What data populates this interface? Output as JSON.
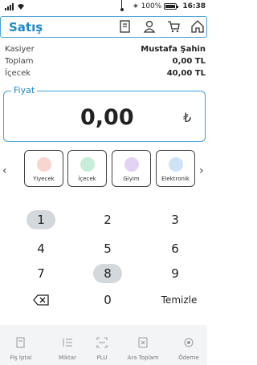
{
  "status_bar": {
    "battery_text": "100%",
    "time": "16:38",
    "icons": [
      "signal-icon",
      "wifi-icon",
      "bluetooth-icon",
      "battery-icon"
    ]
  },
  "header": {
    "title": "Satış",
    "icons": [
      "receipt-icon",
      "user-icon",
      "cart-icon",
      "home-icon"
    ]
  },
  "info": [
    {
      "label": "Kasiyer",
      "value": "Mustafa Şahin"
    },
    {
      "label": "Toplam",
      "value": "0,00 TL"
    },
    {
      "label": "İçecek",
      "value": "40,00 TL"
    }
  ],
  "price": {
    "label": "Fiyat",
    "value": "0,00",
    "currency": "₺"
  },
  "categories": [
    {
      "label": "Yiyecek",
      "icon": "utensils-icon",
      "color": "#f9d5cf"
    },
    {
      "label": "İçecek",
      "icon": "cup-icon",
      "color": "#c7ecd8"
    },
    {
      "label": "Giyim",
      "icon": "shirt-icon",
      "color": "#e3d3f2"
    },
    {
      "label": "Elektronik",
      "icon": "laptop-icon",
      "color": "#cfe3f6"
    }
  ],
  "keypad": {
    "k1": "1",
    "k2": "2",
    "k3": "3",
    "k4": "4",
    "k5": "5",
    "k6": "6",
    "k7": "7",
    "k8": "8",
    "k9": "9",
    "k0": "0",
    "clear": "Temizle"
  },
  "bottom_nav": [
    {
      "label": "Fiş İptal",
      "icon": "receipt-cancel-icon"
    },
    {
      "label": "Miktar",
      "icon": "quantity-icon"
    },
    {
      "label": "PLU",
      "icon": "scan-icon"
    },
    {
      "label": "Ara Toplam",
      "icon": "subtotal-icon"
    },
    {
      "label": "Ödeme",
      "icon": "payment-icon"
    }
  ],
  "colors": {
    "accent": "#1e88c9",
    "border": "#3da0dc",
    "selected_key": "#d4d8dd",
    "nav_bg": "#f3f4f6"
  }
}
